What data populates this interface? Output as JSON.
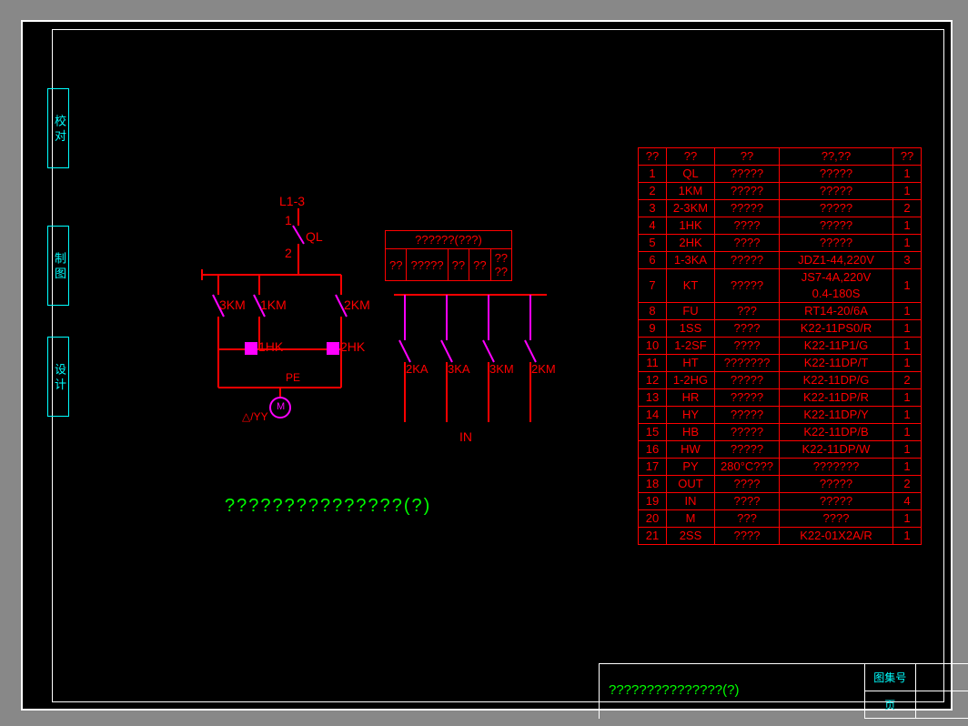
{
  "side_tabs": [
    "校 对",
    "制 图",
    "设 计"
  ],
  "supply": "L1-3",
  "breaker": "QL",
  "contacts": {
    "n1": "1",
    "n2": "2"
  },
  "km": [
    "3KM",
    "1KM",
    "2KM"
  ],
  "hk": [
    "1HK",
    "2HK"
  ],
  "pe": "PE",
  "m": "M",
  "delta_star": "△/YY",
  "small_header": "??????(???)",
  "small_row": [
    "??",
    "?????",
    "??",
    "??",
    "??\n??"
  ],
  "relays": [
    "2KA",
    "3KA",
    "3KM",
    "2KM"
  ],
  "in_label": "IN",
  "caption": "???????????????(?)",
  "parts_header": [
    "??",
    "??",
    "??",
    "??,??",
    "??"
  ],
  "parts_rows": [
    [
      "1",
      "QL",
      "?????",
      "?????",
      "1"
    ],
    [
      "2",
      "1KM",
      "?????",
      "?????",
      "1"
    ],
    [
      "3",
      "2-3KM",
      "?????",
      "?????",
      "2"
    ],
    [
      "4",
      "1HK",
      "????",
      "?????",
      "1"
    ],
    [
      "5",
      "2HK",
      "????",
      "?????",
      "1"
    ],
    [
      "6",
      "1-3KA",
      "?????",
      "JDZ1-44,220V",
      "3"
    ],
    [
      "7",
      "KT",
      "?????",
      "JS7-4A,220V\n0.4-180S",
      "1"
    ],
    [
      "8",
      "FU",
      "???",
      "RT14-20/6A",
      "1"
    ],
    [
      "9",
      "1SS",
      "????",
      "K22-11PS0/R",
      "1"
    ],
    [
      "10",
      "1-2SF",
      "????",
      "K22-11P1/G",
      "1"
    ],
    [
      "11",
      "HT",
      "???????",
      "K22-11DP/T",
      "1"
    ],
    [
      "12",
      "1-2HG",
      "?????",
      "K22-11DP/G",
      "2"
    ],
    [
      "13",
      "HR",
      "?????",
      "K22-11DP/R",
      "1"
    ],
    [
      "14",
      "HY",
      "?????",
      "K22-11DP/Y",
      "1"
    ],
    [
      "15",
      "HB",
      "?????",
      "K22-11DP/B",
      "1"
    ],
    [
      "16",
      "HW",
      "?????",
      "K22-11DP/W",
      "1"
    ],
    [
      "17",
      "PY",
      "280°C???",
      "???????",
      "1"
    ],
    [
      "18",
      "OUT",
      "????",
      "?????",
      "2"
    ],
    [
      "19",
      "IN",
      "????",
      "?????",
      "4"
    ],
    [
      "20",
      "M",
      "???",
      "????",
      "1"
    ],
    [
      "21",
      "2SS",
      "????",
      "K22-01X2A/R",
      "1"
    ]
  ],
  "title_block": {
    "title": "???????????????(?)",
    "r1": "图集号",
    "r2": "页"
  }
}
